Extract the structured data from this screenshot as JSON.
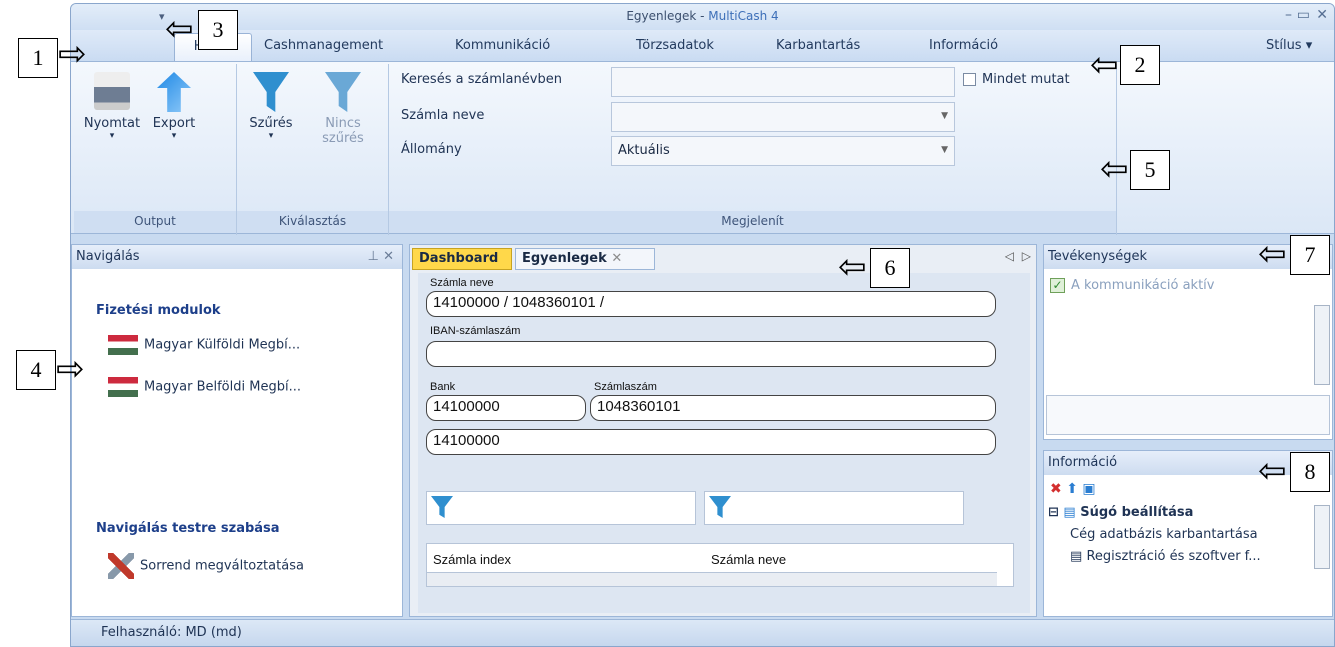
{
  "window": {
    "title_doc": "Egyenlegek - ",
    "title_app": "MultiCash 4"
  },
  "tabs": [
    "Home",
    "Cashmanagement",
    "Kommunikáció",
    "Törzsadatok",
    "Karbantartás",
    "Információ"
  ],
  "style_menu": "Stílus",
  "ribbon": {
    "output": {
      "print": "Nyomtat",
      "export": "Export",
      "label": "Output"
    },
    "selection": {
      "filter": "Szűrés",
      "nofilter_1": "Nincs",
      "nofilter_2": "szűrés",
      "label": "Kiválasztás"
    },
    "display": {
      "search_label": "Keresés a számlanévben",
      "account_label": "Számla neve",
      "state_label": "Állomány",
      "state_value": "Aktuális",
      "show_all": "Mindet mutat",
      "label": "Megjelenít"
    }
  },
  "nav": {
    "title": "Navigálás",
    "section1": "Fizetési modulok",
    "items": [
      "Magyar Külföldi Megbí...",
      "Magyar Belföldi Megbí..."
    ],
    "section2": "Navigálás testre szabása",
    "custom": "Sorrend megváltoztatása"
  },
  "doc_tabs": [
    "Dashboard",
    "Egyenlegek"
  ],
  "form": {
    "account_name_label": "Számla neve",
    "account_name": "14100000 / 1048360101 /",
    "iban_label": "IBAN-számlaszám",
    "iban": "",
    "bank_label": "Bank",
    "bank": "14100000",
    "acct_no_label": "Számlaszám",
    "acct_no": "1048360101",
    "extra": "14100000",
    "col1": "Számla index",
    "col2": "Számla neve"
  },
  "activities": {
    "title": "Tevékenységek",
    "item": "A kommunikáció aktív"
  },
  "info": {
    "title": "Információ",
    "tree_root": "Súgó beállítása",
    "tree_item1": "Cég adatbázis karbantartása",
    "tree_item2": "Regisztráció és szoftver f..."
  },
  "status": "Felhasználó: MD (md)",
  "callouts": [
    "1",
    "2",
    "3",
    "4",
    "5",
    "6",
    "7",
    "8"
  ]
}
